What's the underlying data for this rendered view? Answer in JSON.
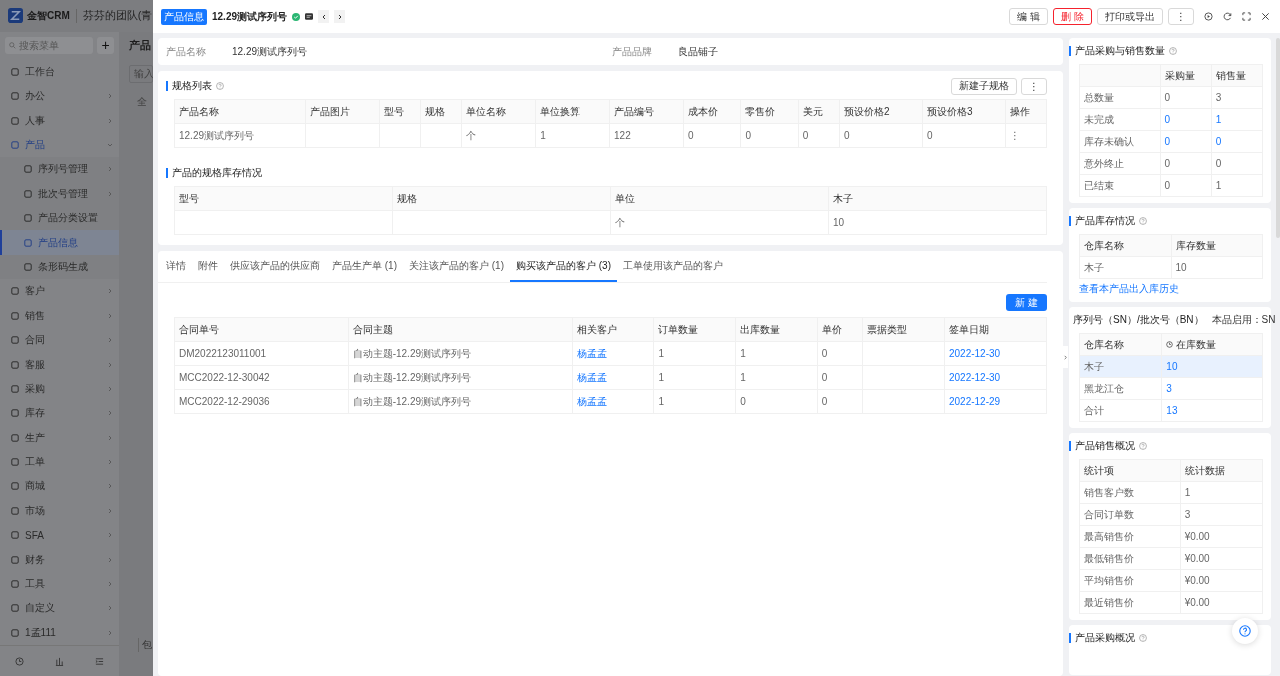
{
  "app": {
    "logo_text": "金智CRM",
    "team": "芬芬的团队(青",
    "search_placeholder": "搜索菜单",
    "add_button": "+"
  },
  "sidebar": {
    "items": [
      {
        "label": "工作台",
        "kind": "link",
        "selected": false
      },
      {
        "label": "办公",
        "kind": "group",
        "selected": false,
        "expanded": false
      },
      {
        "label": "人事",
        "kind": "group",
        "selected": false,
        "expanded": false
      },
      {
        "label": "产品",
        "kind": "group",
        "selected": true,
        "expanded": true,
        "children": [
          {
            "label": "序列号管理",
            "kind": "group",
            "selected": false,
            "expanded": false
          },
          {
            "label": "批次号管理",
            "kind": "group",
            "selected": false,
            "expanded": false
          },
          {
            "label": "产品分类设置",
            "kind": "link",
            "selected": false
          },
          {
            "label": "产品信息",
            "kind": "link",
            "selected": true
          },
          {
            "label": "条形码生成",
            "kind": "link",
            "selected": false
          }
        ]
      },
      {
        "label": "客户",
        "kind": "group",
        "selected": false,
        "expanded": false
      },
      {
        "label": "销售",
        "kind": "group",
        "selected": false,
        "expanded": false
      },
      {
        "label": "合同",
        "kind": "group",
        "selected": false,
        "expanded": false
      },
      {
        "label": "客服",
        "kind": "group",
        "selected": false,
        "expanded": false
      },
      {
        "label": "采购",
        "kind": "group",
        "selected": false,
        "expanded": false
      },
      {
        "label": "库存",
        "kind": "group",
        "selected": false,
        "expanded": false
      },
      {
        "label": "生产",
        "kind": "group",
        "selected": false,
        "expanded": false
      },
      {
        "label": "工单",
        "kind": "group",
        "selected": false,
        "expanded": false
      },
      {
        "label": "商城",
        "kind": "group",
        "selected": false,
        "expanded": false
      },
      {
        "label": "市场",
        "kind": "group",
        "selected": false,
        "expanded": false
      },
      {
        "label": "SFA",
        "kind": "group",
        "selected": false,
        "expanded": false
      },
      {
        "label": "财务",
        "kind": "group",
        "selected": false,
        "expanded": false
      },
      {
        "label": "工具",
        "kind": "group",
        "selected": false,
        "expanded": false
      },
      {
        "label": "自定义",
        "kind": "group",
        "selected": false,
        "expanded": false
      },
      {
        "label": "1孟111",
        "kind": "group",
        "selected": false,
        "expanded": false
      }
    ]
  },
  "backdrop": {
    "page_title": "产品",
    "input_placeholder": "输入",
    "tree_label": "全",
    "checkbox_label": "包"
  },
  "drawer": {
    "tag": "产品信息",
    "title": "12.29测试序列号",
    "actions": [
      {
        "label": "编 辑",
        "kind": "default"
      },
      {
        "label": "删 除",
        "kind": "danger"
      },
      {
        "label": "打印或导出",
        "kind": "default"
      },
      {
        "label": "⋮",
        "kind": "default"
      }
    ]
  },
  "info": [
    {
      "label": "产品名称",
      "value": "12.29测试序列号"
    },
    {
      "label": "产品品牌",
      "value": "良品铺子"
    }
  ],
  "spec": {
    "title": "规格列表",
    "buttons": [
      "新建子规格",
      "⋮"
    ],
    "columns": [
      "产品名称",
      "产品图片",
      "型号",
      "规格",
      "单位名称",
      "单位换算",
      "产品编号",
      "成本价",
      "零售价",
      "美元",
      "预设价格2",
      "预设价格3",
      "操作"
    ],
    "rows": [
      [
        "12.29测试序列号",
        null,
        null,
        null,
        "个",
        "1",
        "122",
        "0",
        "0",
        "0",
        "0",
        "0",
        "⋮"
      ]
    ]
  },
  "spec_stock": {
    "title": "产品的规格库存情况",
    "columns": [
      "型号",
      "规格",
      "单位",
      "木子"
    ],
    "rows": [
      [
        null,
        null,
        "个",
        "10"
      ]
    ]
  },
  "tabs": [
    {
      "label": "详情",
      "selected": false
    },
    {
      "label": "附件",
      "selected": false
    },
    {
      "label": "供应该产品的供应商",
      "selected": false
    },
    {
      "label": "产品生产单 (1)",
      "selected": false
    },
    {
      "label": "关注该产品的客户 (1)",
      "selected": false
    },
    {
      "label": "购买该产品的客户 (3)",
      "selected": true
    },
    {
      "label": "工单使用该产品的客户",
      "selected": false
    }
  ],
  "new_button": "新 建",
  "orders": {
    "columns": [
      "合同单号",
      "合同主题",
      "相关客户",
      "订单数量",
      "出库数量",
      "单价",
      "票据类型",
      "签单日期"
    ],
    "rows": [
      [
        {
          "text": "DM2022123011001",
          "link": false
        },
        {
          "text": "自动主题-12.29测试序列号",
          "link": false
        },
        {
          "text": "杨孟孟",
          "link": true
        },
        {
          "text": "1",
          "link": false
        },
        {
          "text": "1",
          "link": false
        },
        {
          "text": "0",
          "link": false
        },
        null,
        {
          "text": "2022-12-30",
          "link": true
        }
      ],
      [
        {
          "text": "MCC2022-12-30042",
          "link": false
        },
        {
          "text": "自动主题-12.29测试序列号",
          "link": false
        },
        {
          "text": "杨孟孟",
          "link": true
        },
        {
          "text": "1",
          "link": false
        },
        {
          "text": "1",
          "link": false
        },
        {
          "text": "0",
          "link": false
        },
        null,
        {
          "text": "2022-12-30",
          "link": true
        }
      ],
      [
        {
          "text": "MCC2022-12-29036",
          "link": false
        },
        {
          "text": "自动主题-12.29测试序列号",
          "link": false
        },
        {
          "text": "杨孟孟",
          "link": true
        },
        {
          "text": "1",
          "link": false
        },
        {
          "text": "0",
          "link": false
        },
        {
          "text": "0",
          "link": false
        },
        null,
        {
          "text": "2022-12-29",
          "link": true
        }
      ]
    ]
  },
  "purchase_sales": {
    "title": "产品采购与销售数量",
    "columns": [
      "采购量",
      "销售量"
    ],
    "rows": [
      {
        "label": "总数量",
        "cells": [
          {
            "text": "0",
            "link": false
          },
          {
            "text": "3",
            "link": false
          }
        ]
      },
      {
        "label": "未完成",
        "cells": [
          {
            "text": "0",
            "link": true
          },
          {
            "text": "1",
            "link": true
          }
        ]
      },
      {
        "label": "库存未确认",
        "cells": [
          {
            "text": "0",
            "link": true
          },
          {
            "text": "0",
            "link": true
          }
        ]
      },
      {
        "label": "意外终止",
        "cells": [
          {
            "text": "0",
            "link": false
          },
          {
            "text": "0",
            "link": false
          }
        ]
      },
      {
        "label": "已结束",
        "cells": [
          {
            "text": "0",
            "link": false
          },
          {
            "text": "1",
            "link": false
          }
        ]
      }
    ]
  },
  "stock": {
    "title": "产品库存情况",
    "columns": [
      "仓库名称",
      "库存数量"
    ],
    "rows": [
      [
        "木子",
        "10"
      ]
    ],
    "history_link": "查看本产品出入库历史"
  },
  "serial": {
    "title": "序列号（SN）/批次号（BN）",
    "enabled": "本品启用：SN",
    "columns": [
      "仓库名称",
      "在库数量"
    ],
    "rows": [
      {
        "name": "木子",
        "count": "10",
        "selected": true
      },
      {
        "name": "黑龙江仓",
        "count": "3",
        "selected": false
      },
      {
        "name": "合计",
        "count": "13",
        "selected": false
      }
    ]
  },
  "sales_overview": {
    "title": "产品销售概况",
    "columns": [
      "统计项",
      "统计数据"
    ],
    "rows": [
      [
        "销售客户数",
        "1"
      ],
      [
        "合同订单数",
        "3"
      ],
      [
        "最高销售价",
        "¥0.00"
      ],
      [
        "最低销售价",
        "¥0.00"
      ],
      [
        "平均销售价",
        "¥0.00"
      ],
      [
        "最近销售价",
        "¥0.00"
      ]
    ]
  },
  "purchase_overview": {
    "title": "产品采购概况"
  }
}
